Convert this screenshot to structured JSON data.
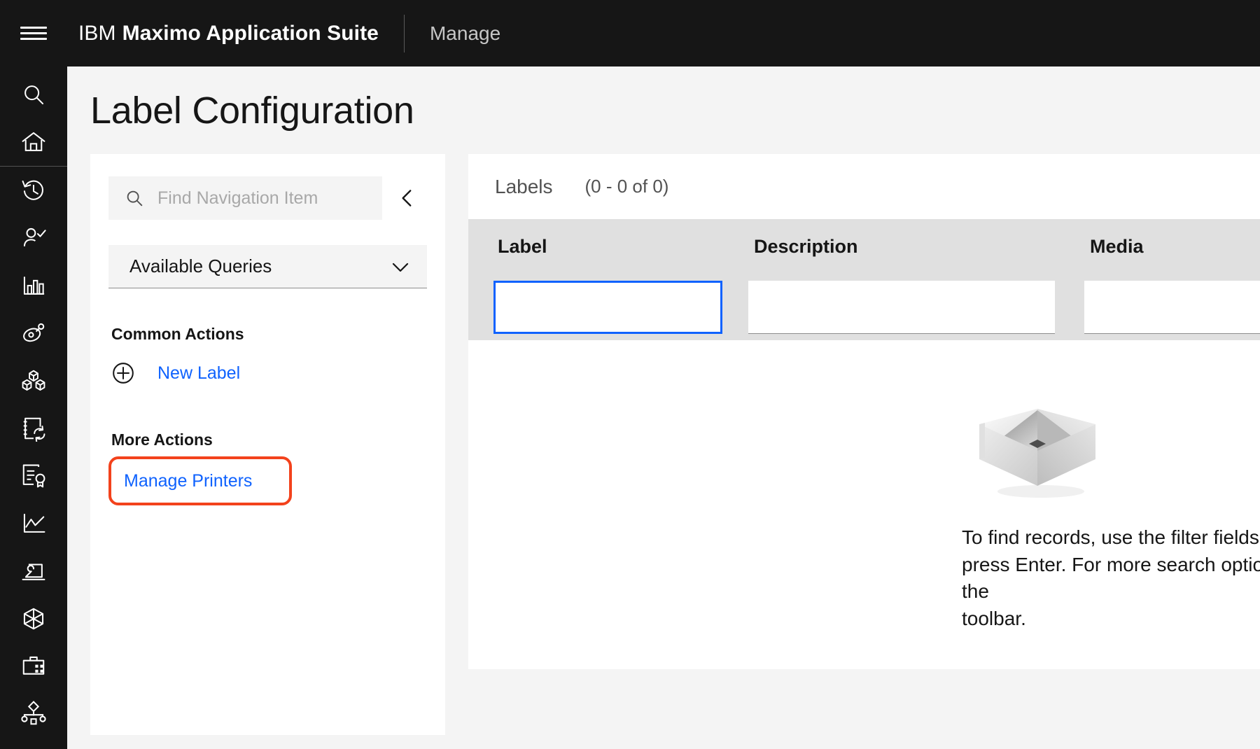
{
  "header": {
    "menu_icon": "hamburger-menu-icon",
    "brand_prefix": "IBM",
    "brand_name": "Maximo Application Suite",
    "app_name": "Manage"
  },
  "icon_rail": {
    "items": [
      {
        "name": "search-icon",
        "label": "Search"
      },
      {
        "name": "home-icon",
        "label": "Home"
      },
      {
        "name": "recently-viewed-icon",
        "label": "Recently Viewed"
      },
      {
        "name": "user-check-icon",
        "label": "Assignments"
      },
      {
        "name": "bar-chart-icon",
        "label": "Reports"
      },
      {
        "name": "asset-tag-icon",
        "label": "Assets"
      },
      {
        "name": "inventory-cubes-icon",
        "label": "Inventory"
      },
      {
        "name": "document-sync-icon",
        "label": "Work Orders"
      },
      {
        "name": "certificate-icon",
        "label": "Contracts"
      },
      {
        "name": "line-chart-icon",
        "label": "Analytics"
      },
      {
        "name": "maintenance-tool-icon",
        "label": "Administration"
      },
      {
        "name": "hexagon-icon",
        "label": "Integration"
      },
      {
        "name": "briefcase-icon",
        "label": "Service Desk"
      },
      {
        "name": "hierarchy-icon",
        "label": "Configuration"
      }
    ]
  },
  "page": {
    "title": "Label Configuration"
  },
  "nav_panel": {
    "search": {
      "icon": "search-icon",
      "placeholder": "Find Navigation Item",
      "value": ""
    },
    "collapse_icon": "chevron-left-icon",
    "queries_dropdown": {
      "label": "Available Queries",
      "icon": "chevron-down-icon"
    },
    "common_actions_heading": "Common Actions",
    "common_actions": [
      {
        "icon": "add-circle-icon",
        "label": "New Label"
      }
    ],
    "more_actions_heading": "More Actions",
    "more_actions": [
      {
        "label": "Manage Printers",
        "highlighted": true
      }
    ],
    "highlight_color": "#f3421c",
    "link_color": "#0f62fe"
  },
  "records_panel": {
    "title": "Labels",
    "count": "(0 - 0 of 0)",
    "columns": [
      "Label",
      "Description",
      "Media"
    ],
    "filters": [
      {
        "column": "Label",
        "value": "",
        "focused": true
      },
      {
        "column": "Description",
        "value": "",
        "focused": false
      },
      {
        "column": "Media",
        "value": "",
        "focused": false
      }
    ],
    "rows": [],
    "empty_state": {
      "illustration": "empty-box-icon",
      "message": "To find records, use the filter fields and then press Enter. For more search options, use the\ntoolbar."
    }
  }
}
